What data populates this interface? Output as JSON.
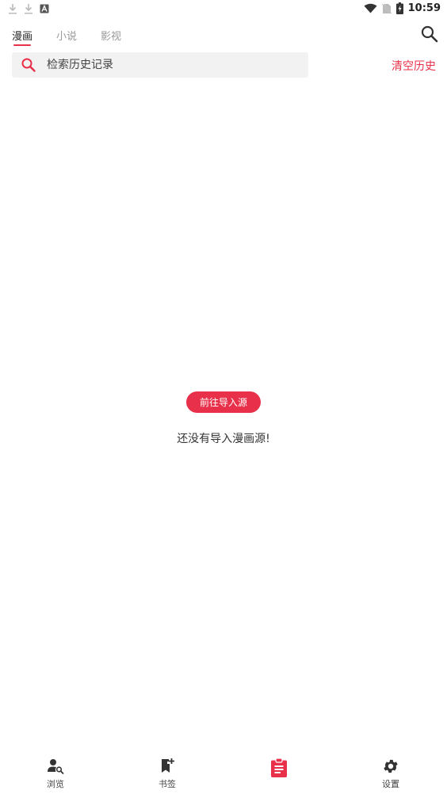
{
  "status_bar": {
    "time": "10:59"
  },
  "tabs": [
    {
      "label": "漫画",
      "active": true
    },
    {
      "label": "小说",
      "active": false
    },
    {
      "label": "影视",
      "active": false
    }
  ],
  "search": {
    "placeholder": "检索历史记录"
  },
  "clear_history_label": "清空历史",
  "empty_state": {
    "button_label": "前往导入源",
    "message": "还没有导入漫画源!"
  },
  "bottom_nav": [
    {
      "label": "浏览",
      "icon": "person-search-icon"
    },
    {
      "label": "书签",
      "icon": "bookmark-add-icon"
    },
    {
      "label": "",
      "icon": "clipboard-list-icon",
      "active": true
    },
    {
      "label": "设置",
      "icon": "gear-icon"
    }
  ],
  "colors": {
    "accent": "#e8304a",
    "search_bg": "#f2f2f2"
  }
}
